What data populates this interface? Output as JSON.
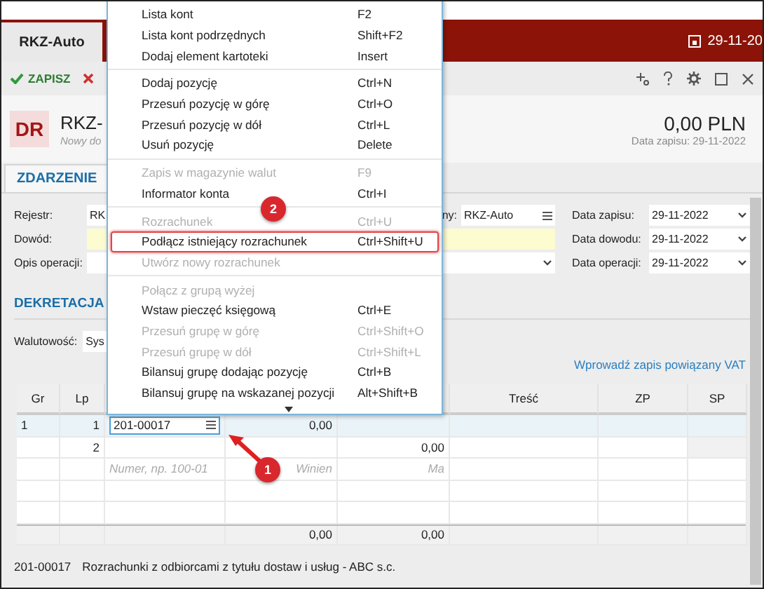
{
  "app_tab": "RKZ-Auto",
  "top_date": "29-11-20",
  "toolbar": {
    "save": "ZAPISZ"
  },
  "document": {
    "badge": "DR",
    "title": "RKZ-",
    "subtitle": "Nowy do",
    "amount": "0,00 PLN",
    "saved_date": "Data zapisu: 29-11-2022"
  },
  "tabs": [
    {
      "label": "ZDARZENIE",
      "selected": true
    }
  ],
  "form": {
    "rejestr": {
      "label": "Rejestr:",
      "value": "RK"
    },
    "dowod": {
      "label": "Dowód:"
    },
    "opis": {
      "label": "Opis operacji:"
    },
    "register_field": {
      "label": "ny:",
      "value": "RKZ-Auto"
    },
    "dates": [
      {
        "label": "Data zapisu:",
        "value": "29-11-2022"
      },
      {
        "label": "Data dowodu:",
        "value": "29-11-2022"
      },
      {
        "label": "Data operacji:",
        "value": "29-11-2022"
      }
    ]
  },
  "section": "DEKRETACJA",
  "currency": {
    "label": "Walutowość:",
    "value": "Sys"
  },
  "vat_link": "Wprowadź zapis powiązany VAT",
  "table": {
    "columns": [
      "Gr",
      "Lp",
      "Treść",
      "ZP",
      "SP"
    ],
    "rows": [
      {
        "selected": true,
        "gr": "1",
        "lp": "1",
        "account": "201-00017",
        "debit": "0,00"
      },
      {
        "selected": false,
        "lp": "2",
        "credit": "0,00"
      }
    ],
    "placeholders": {
      "account": "Numer, np. 100-01",
      "debit": "Winien",
      "credit": "Ma"
    },
    "totals": {
      "debit": "0,00",
      "credit": "0,00"
    }
  },
  "status_bar": {
    "account": "201-00017",
    "description": "Rozrachunki z odbiorcami z tytułu dostaw i usług - ABC s.c."
  },
  "menu": {
    "groups": [
      [
        {
          "label": "Lista kont",
          "shortcut": "F2",
          "disabled": false,
          "selected": false
        },
        {
          "label": "Lista kont podrzędnych",
          "shortcut": "Shift+F2",
          "disabled": false,
          "selected": false
        },
        {
          "label": "Dodaj element kartoteki",
          "shortcut": "Insert",
          "disabled": false,
          "selected": false
        }
      ],
      [
        {
          "label": "Dodaj pozycję",
          "shortcut": "Ctrl+N",
          "disabled": false,
          "selected": false
        },
        {
          "label": "Przesuń pozycję w górę",
          "shortcut": "Ctrl+O",
          "disabled": false,
          "selected": false
        },
        {
          "label": "Przesuń pozycję w dół",
          "shortcut": "Ctrl+L",
          "disabled": false,
          "selected": false
        },
        {
          "label": "Usuń pozycję",
          "shortcut": "Delete",
          "disabled": false,
          "selected": false
        }
      ],
      [
        {
          "label": "Zapis w magazynie walut",
          "shortcut": "F9",
          "disabled": true,
          "selected": false
        },
        {
          "label": "Informator konta",
          "shortcut": "Ctrl+I",
          "disabled": false,
          "selected": false
        }
      ],
      [
        {
          "label": "Rozrachunek",
          "shortcut": "Ctrl+U",
          "disabled": true,
          "selected": false
        },
        {
          "label": "Podłącz istniejący rozrachunek",
          "shortcut": "Ctrl+Shift+U",
          "disabled": false,
          "selected": true
        },
        {
          "label": "Utwórz nowy rozrachunek",
          "disabled": true,
          "selected": false
        }
      ],
      [
        {
          "label": "Połącz z grupą wyżej",
          "disabled": true,
          "selected": false
        },
        {
          "label": "Wstaw pieczęć księgową",
          "shortcut": "Ctrl+E",
          "disabled": false,
          "selected": false
        },
        {
          "label": "Przesuń grupę w górę",
          "shortcut": "Ctrl+Shift+O",
          "disabled": true,
          "selected": false
        },
        {
          "label": "Przesuń grupę w dół",
          "shortcut": "Ctrl+Shift+L",
          "disabled": true,
          "selected": false
        },
        {
          "label": "Bilansuj grupę dodając pozycję",
          "shortcut": "Ctrl+B",
          "disabled": false,
          "selected": false
        },
        {
          "label": "Bilansuj grupę na wskazanej pozycji",
          "shortcut": "Alt+Shift+B",
          "disabled": false,
          "selected": false
        }
      ]
    ]
  },
  "annotations": [
    {
      "label": "2"
    },
    {
      "label": "1"
    }
  ]
}
